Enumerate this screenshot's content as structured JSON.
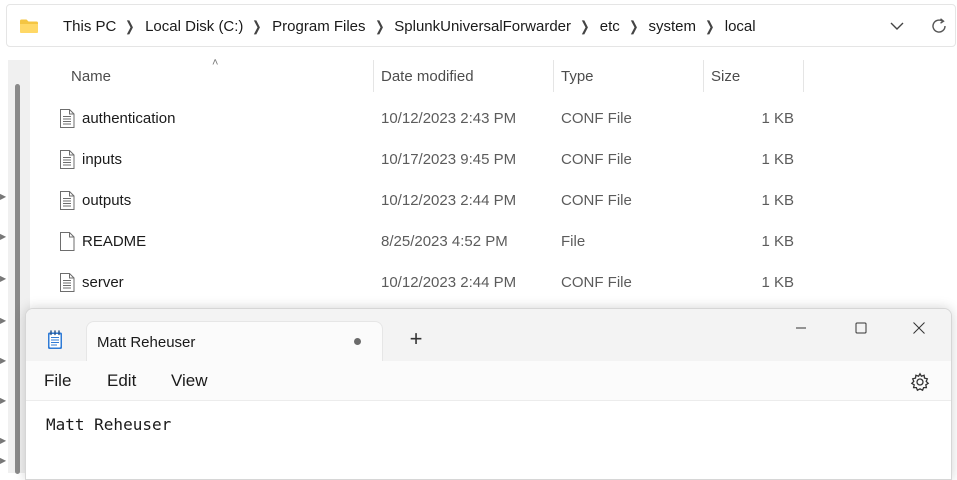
{
  "explorer": {
    "breadcrumbs": [
      "This PC",
      "Local Disk (C:)",
      "Program Files",
      "SplunkUniversalForwarder",
      "etc",
      "system",
      "local"
    ],
    "columns": {
      "name": "Name",
      "date_modified": "Date modified",
      "type": "Type",
      "size": "Size"
    },
    "files": [
      {
        "name": "authentication",
        "date": "10/12/2023 2:43 PM",
        "type": "CONF File",
        "size": "1 KB",
        "icon": "text-file-icon"
      },
      {
        "name": "inputs",
        "date": "10/17/2023 9:45 PM",
        "type": "CONF File",
        "size": "1 KB",
        "icon": "text-file-icon"
      },
      {
        "name": "outputs",
        "date": "10/12/2023 2:44 PM",
        "type": "CONF File",
        "size": "1 KB",
        "icon": "text-file-icon"
      },
      {
        "name": "README",
        "date": "8/25/2023 4:52 PM",
        "type": "File",
        "size": "1 KB",
        "icon": "blank-file-icon"
      },
      {
        "name": "server",
        "date": "10/12/2023 2:44 PM",
        "type": "CONF File",
        "size": "1 KB",
        "icon": "text-file-icon"
      }
    ]
  },
  "notepad": {
    "tab_title": "Matt Reheuser",
    "new_tab_label": "+",
    "menu": {
      "file": "File",
      "edit": "Edit",
      "view": "View"
    },
    "content": "Matt Reheuser"
  },
  "colors": {
    "folder_yellow": "#f4c542",
    "accent_blue": "#2f7bd6"
  }
}
